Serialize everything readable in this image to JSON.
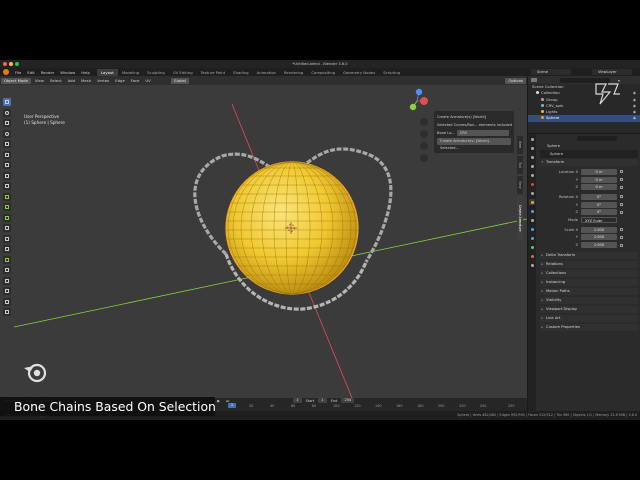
{
  "window": {
    "title": "*Untitled.blend - Blender 3.6.0"
  },
  "topbar": {
    "menus": [
      "File",
      "Edit",
      "Render",
      "Window",
      "Help"
    ],
    "workspaces": [
      "Layout",
      "Modeling",
      "Sculpting",
      "UV Editing",
      "Texture Paint",
      "Shading",
      "Animation",
      "Rendering",
      "Compositing",
      "Geometry Nodes",
      "Scripting"
    ],
    "active_workspace": "Layout",
    "scene": "Scene",
    "view_layer": "ViewLayer"
  },
  "viewport": {
    "mode": "Object Mode",
    "menus": [
      "View",
      "Select",
      "Add",
      "Mesh",
      "Vertex",
      "Edge",
      "Face",
      "UV"
    ],
    "transform_orientation": "Global",
    "options_label": "Options",
    "info_line1": "User Perspective",
    "info_line2": "(1) Sphere | Sphere",
    "n_tabs": [
      "Item",
      "Tool",
      "View",
      "Create Armature"
    ],
    "redo_panel": {
      "title": "Create Armature(s) [World]",
      "selected_label": "Selected Curves/Bon... elements included",
      "bone_label": "Bone Lo...",
      "bone_value": "CRV",
      "button": "Create Armature(s) [World] - Selected..."
    }
  },
  "timeline": {
    "menus": [
      "Playback",
      "View",
      "Marker"
    ],
    "current_frame": "1",
    "start_label": "Start",
    "start_value": "1",
    "end_label": "End",
    "end_value": "250",
    "ruler": [
      "0",
      "20",
      "40",
      "60",
      "80",
      "100",
      "120",
      "140",
      "160",
      "180",
      "200",
      "220",
      "240",
      "250"
    ]
  },
  "status": {
    "left": "Select    Rotate View    Object",
    "right": "Sphere | Verts 482/482 | Edges 992/992 | Faces 512/512 | Tris 960 | Objects 1/1 | Memory 22.6 MiB | 3.6.0"
  },
  "outliner": {
    "root": "Scene Collection",
    "items": [
      {
        "label": "Collection",
        "indent": 1,
        "selected": false
      },
      {
        "label": "Group",
        "indent": 2,
        "selected": false
      },
      {
        "label": "CRV_spin",
        "indent": 2,
        "selected": false
      },
      {
        "label": "Lights",
        "indent": 2,
        "selected": false
      },
      {
        "label": "Sphere",
        "indent": 2,
        "selected": true
      }
    ]
  },
  "properties": {
    "object_name": "Sphere",
    "sub_name": "Sphere",
    "transform_label": "Transform",
    "location_label": "Location X",
    "location": [
      "0 m",
      "0 m",
      "0 m"
    ],
    "rotation_label": "Rotation X",
    "rotation": [
      "0°",
      "0°",
      "0°"
    ],
    "mode_label": "Mode",
    "mode_value": "XYZ Euler",
    "scale_label": "Scale X",
    "scale": [
      "1.000",
      "1.000",
      "1.000"
    ],
    "axis_y": "Y",
    "axis_z": "Z",
    "panels": [
      "Delta Transform",
      "Relations",
      "Collections",
      "Instancing",
      "Motion Paths",
      "Visibility",
      "Viewport Display",
      "Line Art",
      "Custom Properties"
    ]
  },
  "caption": "Bone Chains Based On Selection",
  "colors": {
    "accent": "#4772b3",
    "sphere": "#f0c830",
    "selection_outline": "#f5a623",
    "x_axis": "#e34c4c",
    "y_axis": "#8bd13f"
  }
}
